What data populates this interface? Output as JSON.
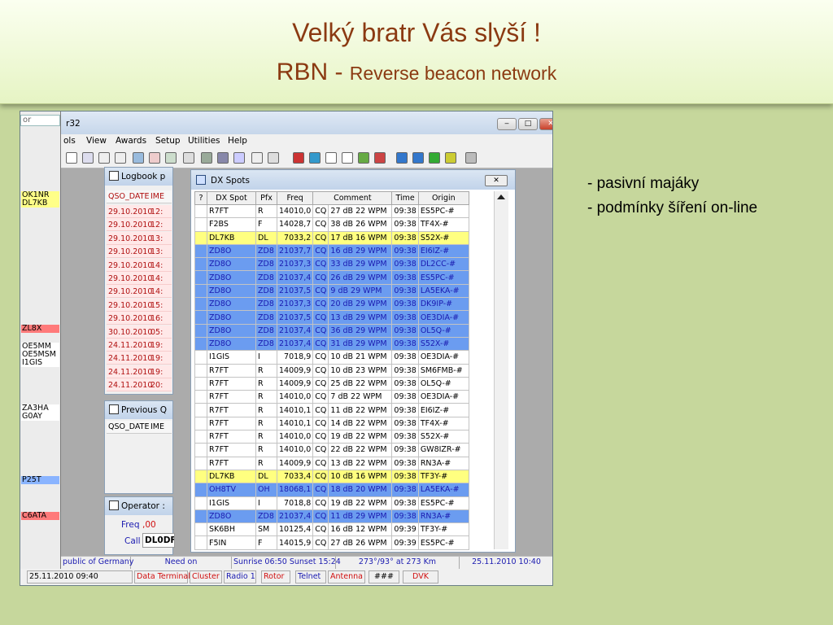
{
  "slide": {
    "title_line1": "Velký bratr Vás slyší !",
    "title_line2_main": "RBN - ",
    "title_line2_sub": "Reverse beacon network",
    "notes": [
      "- pasivní majáky",
      "- podmínky šíření on-line"
    ]
  },
  "app": {
    "title": "r32",
    "left_top": "or",
    "left_calls": [
      {
        "text": "OK1NR\nDL7KB",
        "color": "yellow"
      },
      {
        "text": "ZL8X",
        "color": "red"
      },
      {
        "text": "OE5MM\nOE5MSM\nI1GIS",
        "color": "white"
      },
      {
        "text": "ZA3HA\nG0AY",
        "color": "white"
      },
      {
        "text": "P25T",
        "color": "blue"
      },
      {
        "text": "C6ATA",
        "color": "red"
      }
    ],
    "menu": [
      "ols",
      "View",
      "Awards",
      "Setup",
      "Utilities",
      "Help"
    ],
    "logbook": {
      "title": "Logbook p",
      "head_date": "QSO_DATE",
      "head_time": "IME",
      "rows": [
        {
          "date": "29.10.2010",
          "time": "12:"
        },
        {
          "date": "29.10.2010",
          "time": "12:"
        },
        {
          "date": "29.10.2010",
          "time": "13:"
        },
        {
          "date": "29.10.2010",
          "time": "13:"
        },
        {
          "date": "29.10.2010",
          "time": "14:"
        },
        {
          "date": "29.10.2010",
          "time": "14:"
        },
        {
          "date": "29.10.2010",
          "time": "14:"
        },
        {
          "date": "29.10.2010",
          "time": "15:"
        },
        {
          "date": "29.10.2010",
          "time": "16:"
        },
        {
          "date": "30.10.2010",
          "time": "05:"
        },
        {
          "date": "24.11.2010",
          "time": "19:"
        },
        {
          "date": "24.11.2010",
          "time": "19:"
        },
        {
          "date": "24.11.2010",
          "time": "19:"
        },
        {
          "date": "24.11.2010",
          "time": "20:"
        }
      ]
    },
    "previous": {
      "title": "Previous Q",
      "head_date": "QSO_DATE",
      "head_time": "IME"
    },
    "operator": {
      "title": "Operator :",
      "freq_label": "Freq",
      "freq_value": ",00",
      "call_label": "Call",
      "call_value": "DL0DF"
    },
    "dxspots": {
      "title": "DX Spots",
      "close": "✕",
      "headers": [
        "?",
        "DX Spot",
        "Pfx",
        "Freq",
        "Comment",
        "Time",
        "Origin"
      ],
      "rows": [
        {
          "spot": "R7FT",
          "pfx": "R",
          "freq": "14010,0",
          "mode": "CQ",
          "comment": "27 dB 22 WPM",
          "time": "09:38",
          "origin": "ES5PC-#",
          "hl": ""
        },
        {
          "spot": "F2BS",
          "pfx": "F",
          "freq": "14028,7",
          "mode": "CQ",
          "comment": "38 dB 26 WPM",
          "time": "09:38",
          "origin": "TF4X-#",
          "hl": ""
        },
        {
          "spot": "DL7KB",
          "pfx": "DL",
          "freq": "7033,2",
          "mode": "CQ",
          "comment": "17 dB 16 WPM",
          "time": "09:38",
          "origin": "S52X-#",
          "hl": "yellow"
        },
        {
          "spot": "ZD8O",
          "pfx": "ZD8",
          "freq": "21037,7",
          "mode": "CQ",
          "comment": "16 dB 29 WPM",
          "time": "09:38",
          "origin": "EI6IZ-#",
          "hl": "blue"
        },
        {
          "spot": "ZD8O",
          "pfx": "ZD8",
          "freq": "21037,3",
          "mode": "CQ",
          "comment": "33 dB 29 WPM",
          "time": "09:38",
          "origin": "DL2CC-#",
          "hl": "blue"
        },
        {
          "spot": "ZD8O",
          "pfx": "ZD8",
          "freq": "21037,4",
          "mode": "CQ",
          "comment": "26 dB 29 WPM",
          "time": "09:38",
          "origin": "ES5PC-#",
          "hl": "blue"
        },
        {
          "spot": "ZD8O",
          "pfx": "ZD8",
          "freq": "21037,5",
          "mode": "CQ",
          "comment": "9 dB 29 WPM",
          "time": "09:38",
          "origin": "LA5EKA-#",
          "hl": "blue"
        },
        {
          "spot": "ZD8O",
          "pfx": "ZD8",
          "freq": "21037,3",
          "mode": "CQ",
          "comment": "20 dB 29 WPM",
          "time": "09:38",
          "origin": "DK9IP-#",
          "hl": "blue"
        },
        {
          "spot": "ZD8O",
          "pfx": "ZD8",
          "freq": "21037,5",
          "mode": "CQ",
          "comment": "13 dB 29 WPM",
          "time": "09:38",
          "origin": "OE3DIA-#",
          "hl": "blue"
        },
        {
          "spot": "ZD8O",
          "pfx": "ZD8",
          "freq": "21037,4",
          "mode": "CQ",
          "comment": "36 dB 29 WPM",
          "time": "09:38",
          "origin": "OL5Q-#",
          "hl": "blue"
        },
        {
          "spot": "ZD8O",
          "pfx": "ZD8",
          "freq": "21037,4",
          "mode": "CQ",
          "comment": "31 dB 29 WPM",
          "time": "09:38",
          "origin": "S52X-#",
          "hl": "blue"
        },
        {
          "spot": "I1GIS",
          "pfx": "I",
          "freq": "7018,9",
          "mode": "CQ",
          "comment": "10 dB 21 WPM",
          "time": "09:38",
          "origin": "OE3DIA-#",
          "hl": ""
        },
        {
          "spot": "R7FT",
          "pfx": "R",
          "freq": "14009,9",
          "mode": "CQ",
          "comment": "10 dB 23 WPM",
          "time": "09:38",
          "origin": "SM6FMB-#",
          "hl": ""
        },
        {
          "spot": "R7FT",
          "pfx": "R",
          "freq": "14009,9",
          "mode": "CQ",
          "comment": "25 dB 22 WPM",
          "time": "09:38",
          "origin": "OL5Q-#",
          "hl": ""
        },
        {
          "spot": "R7FT",
          "pfx": "R",
          "freq": "14010,0",
          "mode": "CQ",
          "comment": "7 dB 22 WPM",
          "time": "09:38",
          "origin": "OE3DIA-#",
          "hl": ""
        },
        {
          "spot": "R7FT",
          "pfx": "R",
          "freq": "14010,1",
          "mode": "CQ",
          "comment": "11 dB 22 WPM",
          "time": "09:38",
          "origin": "EI6IZ-#",
          "hl": ""
        },
        {
          "spot": "R7FT",
          "pfx": "R",
          "freq": "14010,1",
          "mode": "CQ",
          "comment": "14 dB 22 WPM",
          "time": "09:38",
          "origin": "TF4X-#",
          "hl": ""
        },
        {
          "spot": "R7FT",
          "pfx": "R",
          "freq": "14010,0",
          "mode": "CQ",
          "comment": "19 dB 22 WPM",
          "time": "09:38",
          "origin": "S52X-#",
          "hl": ""
        },
        {
          "spot": "R7FT",
          "pfx": "R",
          "freq": "14010,0",
          "mode": "CQ",
          "comment": "22 dB 22 WPM",
          "time": "09:38",
          "origin": "GW8IZR-#",
          "hl": ""
        },
        {
          "spot": "R7FT",
          "pfx": "R",
          "freq": "14009,9",
          "mode": "CQ",
          "comment": "13 dB 22 WPM",
          "time": "09:38",
          "origin": "RN3A-#",
          "hl": ""
        },
        {
          "spot": "DL7KB",
          "pfx": "DL",
          "freq": "7033,4",
          "mode": "CQ",
          "comment": "10 dB 16 WPM",
          "time": "09:38",
          "origin": "TF3Y-#",
          "hl": "yellow"
        },
        {
          "spot": "OH8TV",
          "pfx": "OH",
          "freq": "18068,1",
          "mode": "CQ",
          "comment": "18 dB 20 WPM",
          "time": "09:38",
          "origin": "LA5EKA-#",
          "hl": "blue"
        },
        {
          "spot": "I1GIS",
          "pfx": "I",
          "freq": "7018,8",
          "mode": "CQ",
          "comment": "19 dB 22 WPM",
          "time": "09:38",
          "origin": "ES5PC-#",
          "hl": ""
        },
        {
          "spot": "ZD8O",
          "pfx": "ZD8",
          "freq": "21037,4",
          "mode": "CQ",
          "comment": "11 dB 29 WPM",
          "time": "09:38",
          "origin": "RN3A-#",
          "hl": "blue"
        },
        {
          "spot": "SK6BH",
          "pfx": "SM",
          "freq": "10125,4",
          "mode": "CQ",
          "comment": "16 dB 12 WPM",
          "time": "09:39",
          "origin": "TF3Y-#",
          "hl": ""
        },
        {
          "spot": "F5IN",
          "pfx": "F",
          "freq": "14015,9",
          "mode": "CQ",
          "comment": "27 dB 26 WPM",
          "time": "09:39",
          "origin": "ES5PC-#",
          "hl": ""
        }
      ]
    },
    "status1": {
      "country": "public of Germany",
      "need": "Need on",
      "sun": "Sunrise 06:50 Sunset 15:24",
      "bearing": "273°/93° at  273 Km",
      "datetime": "25.11.2010  10:40"
    },
    "status2": {
      "date": "25.11.2010  09:40",
      "items": [
        "Data Terminal",
        "Cluster",
        "Radio 1",
        "Rotor",
        "Telnet",
        "Antenna",
        "###",
        "DVK"
      ]
    },
    "colors": {
      "highlight_yellow": "#ffff80",
      "highlight_blue": "#6b9cf0",
      "log_red": "#b01010"
    }
  }
}
